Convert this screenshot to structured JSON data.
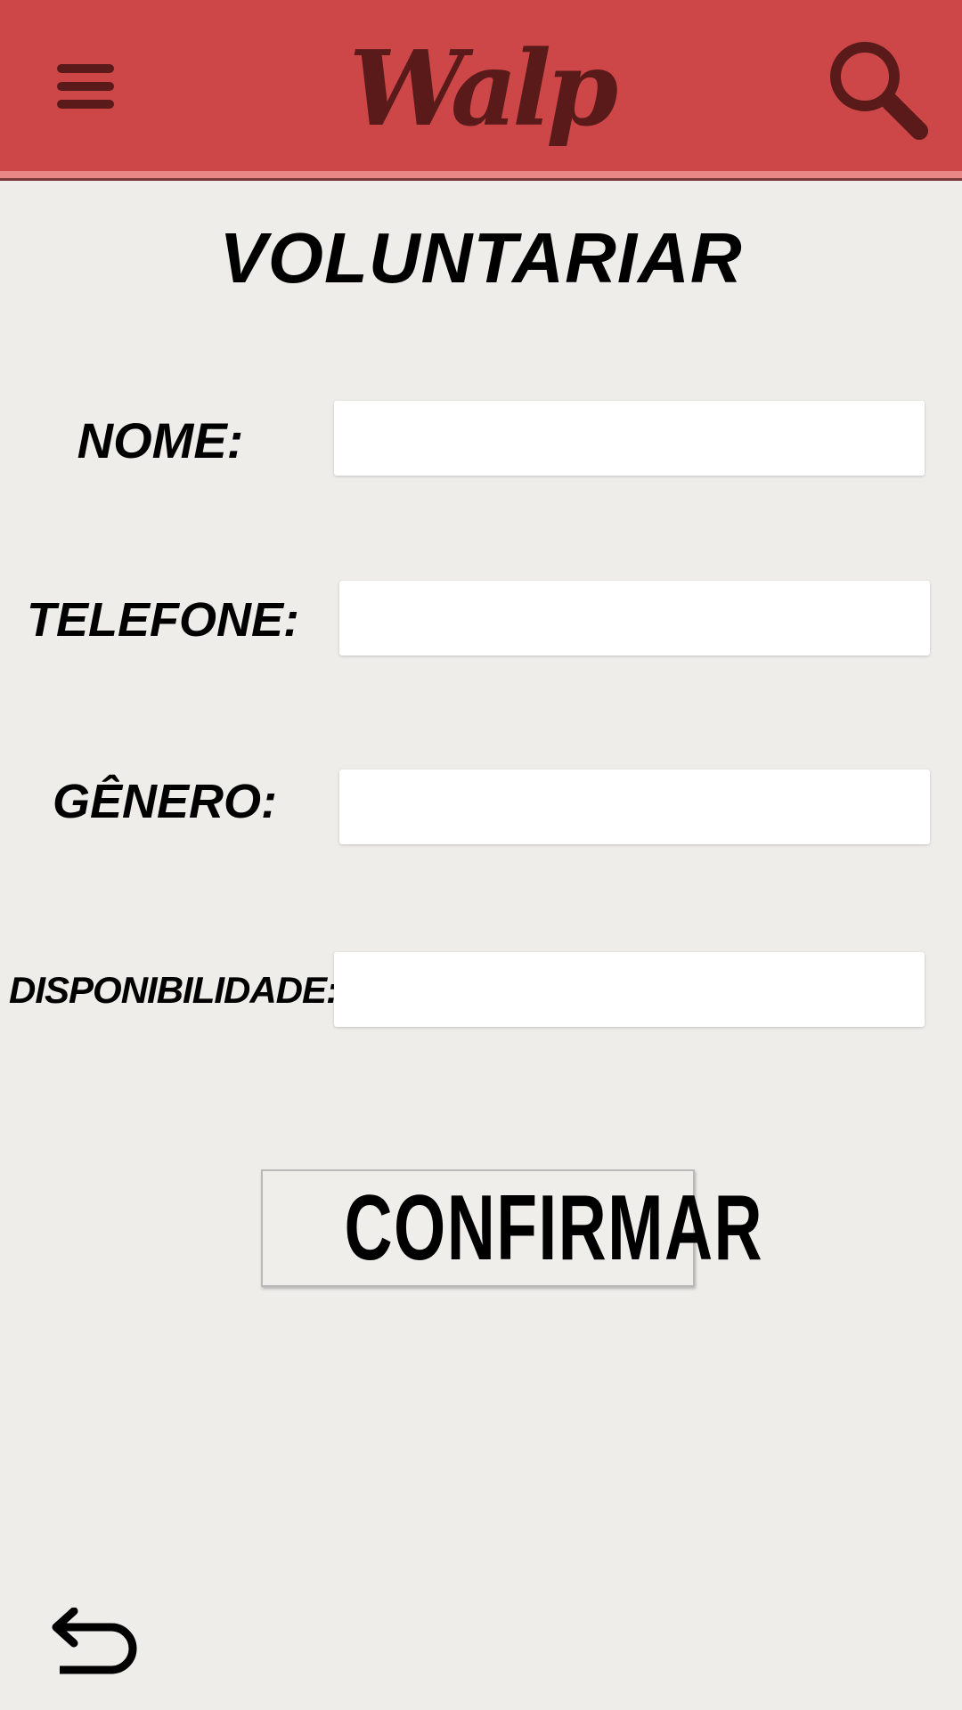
{
  "header": {
    "logo_text": "Walp",
    "menu_icon": "hamburger-menu-icon",
    "search_icon": "search-icon",
    "colors": {
      "background": "#cd4749",
      "foreground": "#5a1a1a"
    }
  },
  "page": {
    "title": "VOLUNTARIAR"
  },
  "form": {
    "fields": [
      {
        "label": "NOME:",
        "value": "",
        "placeholder": ""
      },
      {
        "label": "TELEFONE:",
        "value": "",
        "placeholder": ""
      },
      {
        "label": "GÊNERO:",
        "value": "",
        "placeholder": ""
      },
      {
        "label": "DISPONIBILIDADE:",
        "value": "",
        "placeholder": ""
      }
    ],
    "confirm_label": "CONFIRMAR"
  },
  "footer": {
    "back_icon": "back-arrow-icon"
  }
}
